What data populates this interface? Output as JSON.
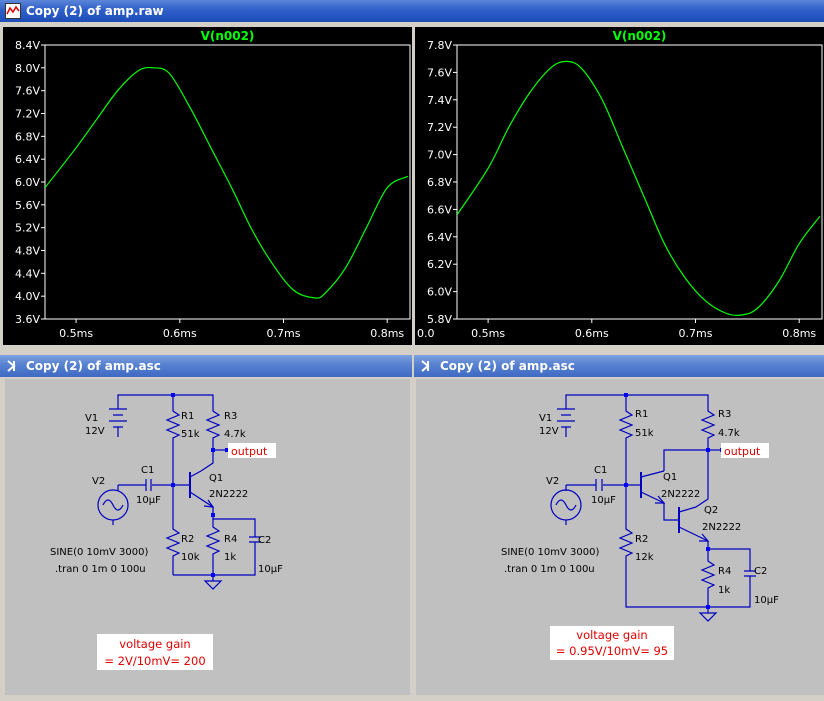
{
  "plot_window": {
    "title": "Copy (2) of amp.raw",
    "colors": {
      "background": "#000000",
      "trace": "#00ff00",
      "axis_text": "#ffffff",
      "trace_label": "#00ff00"
    }
  },
  "schematic_windows": [
    {
      "title": "Copy (2) of amp.asc"
    },
    {
      "title": "Copy (2) of amp.asc"
    }
  ],
  "chart_data": [
    {
      "type": "line",
      "title": "V(n002)",
      "xlabel": "",
      "ylabel": "",
      "x_ticks": [
        "0.5ms",
        "0.6ms",
        "0.7ms",
        "0.8ms"
      ],
      "y_ticks": [
        "8.4V",
        "8.0V",
        "7.6V",
        "7.2V",
        "6.8V",
        "6.4V",
        "6.0V",
        "5.6V",
        "5.2V",
        "4.8V",
        "4.4V",
        "4.0V",
        "3.6V"
      ],
      "xlim": [
        0.47,
        0.822
      ],
      "ylim": [
        3.6,
        8.4
      ],
      "series": [
        {
          "name": "V(n002)",
          "color": "#00ff00",
          "x": [
            0.47,
            0.5,
            0.52,
            0.54,
            0.56,
            0.575,
            0.59,
            0.61,
            0.63,
            0.65,
            0.67,
            0.69,
            0.71,
            0.73,
            0.74,
            0.76,
            0.78,
            0.8,
            0.82
          ],
          "y": [
            5.9,
            6.6,
            7.1,
            7.6,
            7.95,
            8.0,
            7.9,
            7.3,
            6.6,
            5.9,
            5.15,
            4.55,
            4.1,
            3.97,
            4.05,
            4.5,
            5.2,
            5.9,
            6.1
          ]
        }
      ]
    },
    {
      "type": "line",
      "title": "V(n002)",
      "xlabel": "",
      "ylabel": "",
      "x_ticks": [
        "0.0",
        "0.5ms",
        "0.6ms",
        "0.7ms",
        "0.8ms"
      ],
      "y_ticks": [
        "7.8V",
        "7.6V",
        "7.4V",
        "7.2V",
        "7.0V",
        "6.8V",
        "6.6V",
        "6.4V",
        "6.2V",
        "6.0V",
        "5.8V"
      ],
      "xlim": [
        0.47,
        0.822
      ],
      "ylim": [
        5.8,
        7.8
      ],
      "series": [
        {
          "name": "V(n002)",
          "color": "#00ff00",
          "x": [
            0.47,
            0.5,
            0.52,
            0.54,
            0.56,
            0.575,
            0.59,
            0.61,
            0.63,
            0.65,
            0.67,
            0.69,
            0.71,
            0.73,
            0.745,
            0.76,
            0.78,
            0.8,
            0.82
          ],
          "y": [
            6.56,
            6.9,
            7.2,
            7.45,
            7.63,
            7.68,
            7.63,
            7.4,
            7.05,
            6.7,
            6.35,
            6.1,
            5.93,
            5.84,
            5.83,
            5.88,
            6.07,
            6.35,
            6.55
          ]
        }
      ]
    }
  ],
  "circuit1": {
    "v1_name": "V1",
    "v1_value": "12V",
    "v2_name": "V2",
    "c1_name": "C1",
    "c1_value": "10µF",
    "r1_name": "R1",
    "r1_value": "51k",
    "r2_name": "R2",
    "r2_value": "10k",
    "r3_name": "R3",
    "r3_value": "4.7k",
    "r4_name": "R4",
    "r4_value": "1k",
    "c2_name": "C2",
    "c2_value": "10µF",
    "q1_name": "Q1",
    "q1_model": "2N2222",
    "output_label": "output",
    "source_spec": "SINE(0 10mV 3000)",
    "tran_directive": ".tran 0 1m 0 100u",
    "gain_title": "voltage gain",
    "gain_formula": "= 2V/10mV= 200"
  },
  "circuit2": {
    "v1_name": "V1",
    "v1_value": "12V",
    "v2_name": "V2",
    "c1_name": "C1",
    "c1_value": "10µF",
    "r1_name": "R1",
    "r1_value": "51k",
    "r2_name": "R2",
    "r2_value": "12k",
    "r3_name": "R3",
    "r3_value": "4.7k",
    "r4_name": "R4",
    "r4_value": "1k",
    "c2_name": "C2",
    "c2_value": "10µF",
    "q1_name": "Q1",
    "q1_model": "2N2222",
    "q2_name": "Q2",
    "q2_model": "2N2222",
    "output_label": "output",
    "source_spec": "SINE(0 10mV 3000)",
    "tran_directive": ".tran 0 1m 0 100u",
    "gain_title": "voltage gain",
    "gain_formula": "= 0.95V/10mV= 95"
  }
}
